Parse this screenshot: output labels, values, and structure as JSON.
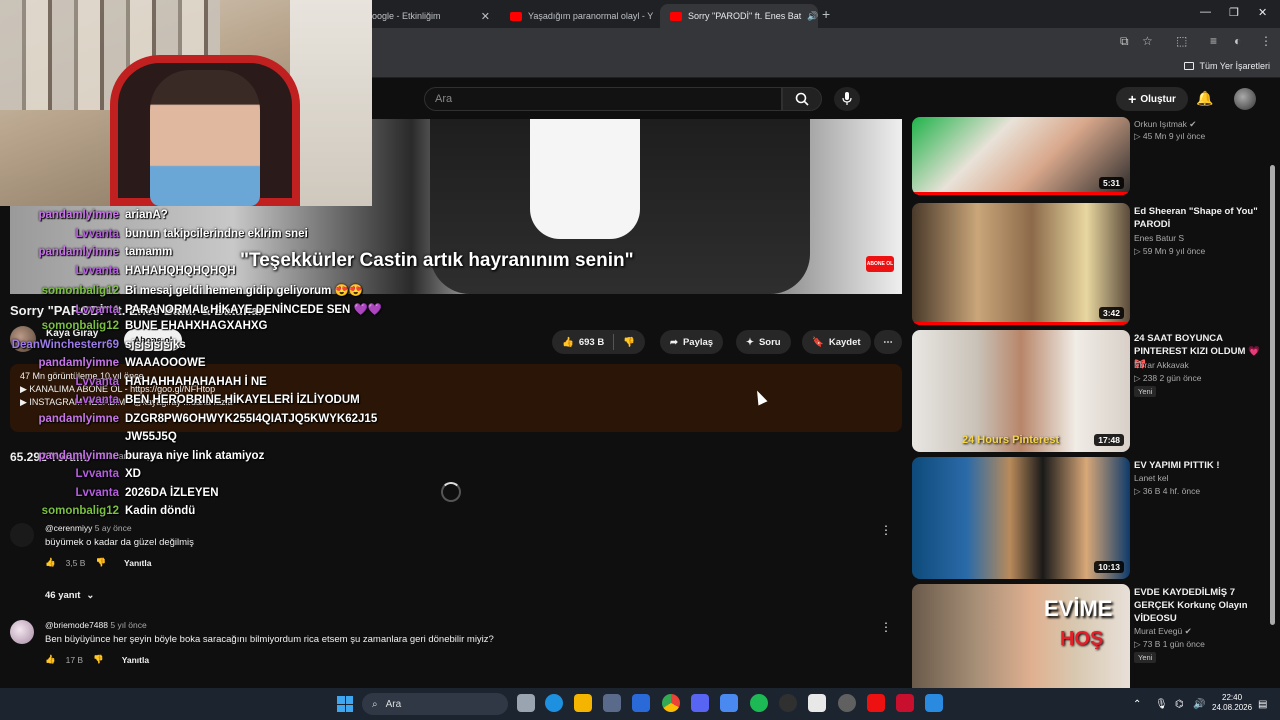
{
  "browser": {
    "tabs": [
      {
        "label": "oogle - Etkinliğim"
      },
      {
        "label": "Yaşadığım paranormal olayl - Y"
      },
      {
        "label": "Sorry \"PARODİ\" ft. Enes Bat"
      }
    ],
    "bookmarks_label": "Tüm Yer İşaretleri"
  },
  "youtube": {
    "search_placeholder": "Ara",
    "create_label": "Oluştur"
  },
  "video": {
    "subtitle": "\"Teşekkürler Castin artık hayranınım senin\"",
    "badge": "ABONE OL",
    "title": "Sorry \"PARODİ\" ft. Enes Batur & Batuhan",
    "channel_name": "Kaya Giray",
    "subs": "",
    "subscribe_label": "Abone ol",
    "likes": "693 B",
    "share_label": "Paylaş",
    "ask_label": "Soru",
    "save_label": "Kaydet",
    "desc_line1": "47 Mn görüntüleme  10 yıl önce",
    "desc_line2": "▶ KANALIMA ABONE OL - https://goo.gl/NFHtop",
    "desc_line3": "▶ INSTAGRAM HESABIM - @kayagiray ...daha fazla",
    "comments_count": "65.292 Yorum",
    "sort_label": "Sıralama ölçütü"
  },
  "chat": [
    {
      "name": "pandamlyimne",
      "msg": "arianA?",
      "color": "#c774e8"
    },
    {
      "name": "Lvvanta",
      "msg": "bunun takipcilerindne eklrim snei",
      "color": "#b65ee0"
    },
    {
      "name": "pandamlyimne",
      "msg": "tamamm",
      "color": "#c774e8"
    },
    {
      "name": "Lvvanta",
      "msg": "HAHAHQHQHQHQH",
      "color": "#b65ee0"
    },
    {
      "name": "somonbalig12",
      "msg": "Bi mesaj geldi hemen gidip geliyorum 😍😍",
      "color": "#7bc043"
    },
    {
      "name": "Lvvanta",
      "msg": "PARANORMAL HİKAYE DENİNCEDE SEN 💜💜",
      "color": "#b65ee0"
    },
    {
      "name": "somonbalig12",
      "msg": "BUNE EHAHXHAGXAHXG",
      "color": "#7bc043"
    },
    {
      "name": "DeanWinchesterr69",
      "msg": "sjsjsjsjsjks",
      "color": "#9d7be8"
    },
    {
      "name": "pandamlyimne",
      "msg": "WAAAOOOWE",
      "color": "#c774e8"
    },
    {
      "name": "Lvvanta",
      "msg": "HAHAHHAHAHAHAH İ NE",
      "color": "#b65ee0"
    },
    {
      "name": "Lvvanta",
      "msg": "BEN HEROBRINE HİKAYELERİ İZLİYODUM",
      "color": "#b65ee0"
    },
    {
      "name": "pandamlyimne",
      "msg": "DZGR8PW6OHWYK255I4QIATJQ5KWYK62J15",
      "color": "#c774e8"
    },
    {
      "name": "",
      "msg": "JW55J5Q",
      "color": "#c774e8"
    },
    {
      "name": "pandamlyimne",
      "msg": "buraya niye link atamiyoz",
      "color": "#c774e8"
    },
    {
      "name": "Lvvanta",
      "msg": "XD",
      "color": "#b65ee0"
    },
    {
      "name": "Lvvanta",
      "msg": "2026DA İZLEYEN",
      "color": "#b65ee0"
    },
    {
      "name": "somonbalig12",
      "msg": "Kadin döndü",
      "color": "#7bc043"
    }
  ],
  "comments": [
    {
      "handle": "@cerenmiyy",
      "ago": "5 ay önce",
      "text": "büyümek o kadar da güzel değilmiş",
      "likes": "3,5 B",
      "reply": "Yanıtla",
      "replies": "46 yanıt"
    },
    {
      "handle": "@briemode7488",
      "ago": "5 yıl önce",
      "text": "Ben büyüyünce her şeyin böyle boka saracağını bilmiyordum rica etsem şu zamanlara geri dönebilir miyiz?",
      "likes": "17 B",
      "reply": "Yanıtla"
    }
  ],
  "recommendations": [
    {
      "title": "",
      "channel": "Orkun Işıtmak",
      "meta": "▷ 45 Mn  9 yıl önce",
      "duration": "5:31",
      "progress": 1.0
    },
    {
      "title": "Ed Sheeran  \"Shape of You\" PARODİ",
      "channel": "Enes Batur S",
      "meta": "▷ 59 Mn  9 yıl önce",
      "duration": "3:42",
      "progress": 1.0
    },
    {
      "title": "24 SAAT BOYUNCA PINTEREST KIZI OLDUM 💗🎀",
      "channel": "Ebrar Akkavak",
      "meta": "▷ 238  2 gün önce",
      "duration": "17:48",
      "badge": "Yeni",
      "progress": 0
    },
    {
      "title": "EV YAPIMI PITTIK !",
      "channel": "Lanet kel",
      "meta": "▷ 36 B  4 hf. önce",
      "duration": "10:13",
      "progress": 0
    },
    {
      "title": "EVDE KAYDEDİLMİŞ 7 GERÇEK Korkunç Olayın VİDEOSU",
      "channel": "Murat Evegü",
      "meta": "▷ 73 B  1 gün önce",
      "badge": "Yeni",
      "progress": 0
    }
  ],
  "taskbar": {
    "search_label": "Ara",
    "time": "22:40",
    "date": "24.08.2026"
  }
}
